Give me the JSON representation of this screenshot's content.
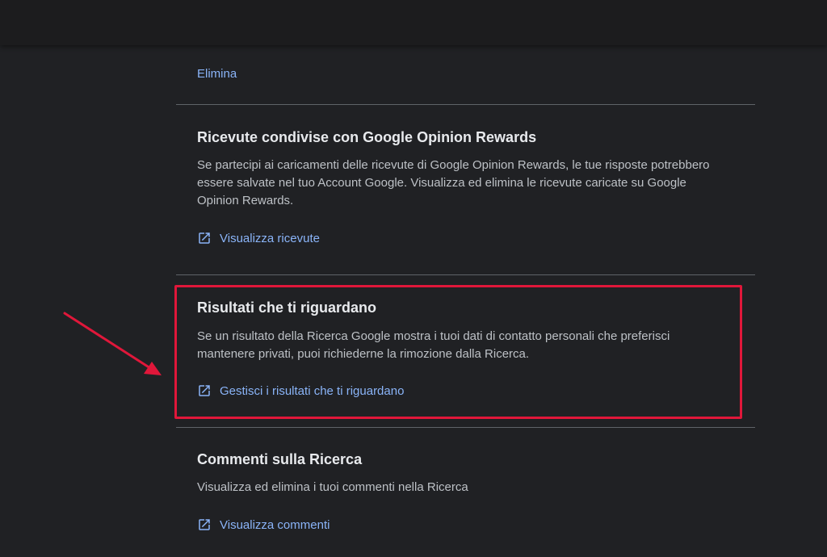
{
  "top_link": {
    "label": "Elimina"
  },
  "sections": [
    {
      "title": "Ricevute condivise con Google Opinion Rewards",
      "description": "Se partecipi ai caricamenti delle ricevute di Google Opinion Rewards, le tue risposte potrebbero essere salvate nel tuo Account Google. Visualizza ed elimina le ricevute caricate su Google Opinion Rewards.",
      "link_label": "Visualizza ricevute",
      "link_icon": "open-in-new-icon"
    },
    {
      "title": "Risultati che ti riguardano",
      "description": "Se un risultato della Ricerca Google mostra i tuoi dati di contatto personali che preferisci mantenere privati, puoi richiederne la rimozione dalla Ricerca.",
      "link_label": "Gestisci i risultati che ti riguardano",
      "link_icon": "open-in-new-icon"
    },
    {
      "title": "Commenti sulla Ricerca",
      "description": "Visualizza ed elimina i tuoi commenti nella Ricerca",
      "link_label": "Visualizza commenti",
      "link_icon": "open-in-new-icon"
    }
  ],
  "colors": {
    "background": "#202124",
    "link": "#8ab4f8",
    "title": "#e8eaed",
    "body_text": "#bdc1c6",
    "divider": "#5f6368",
    "annotation": "#e0173a"
  }
}
